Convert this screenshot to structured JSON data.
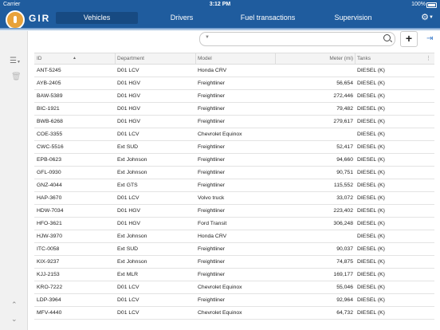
{
  "status_bar": {
    "carrier": "Carrier",
    "time": "3:12 PM",
    "battery": "100%"
  },
  "app": {
    "logo_text": "GIR",
    "tabs": [
      "Vehicles",
      "Drivers",
      "Fuel transactions",
      "Supervision"
    ],
    "active_tab": "Vehicles"
  },
  "icons": {
    "settings": "gear-icon",
    "menu": "list-menu-icon",
    "delete": "trash-icon",
    "search": "search-icon",
    "add": "plus-icon",
    "exit": "exit-icon",
    "scroll_up": "chevron-up-icon",
    "scroll_down": "chevron-down-icon"
  },
  "filter": {
    "placeholder": ""
  },
  "add_label": "+",
  "table": {
    "columns": [
      "ID",
      "Department",
      "Model",
      "Meter (mi)",
      "Tanks"
    ],
    "rows": [
      [
        "ANT-5245",
        "D01 LCV",
        "Honda CRV",
        "",
        "DIESEL (K)"
      ],
      [
        "AYB-2405",
        "D01 HGV",
        "Freightliner",
        "56,654",
        "DIESEL (K)"
      ],
      [
        "BAW-5389",
        "D01 HGV",
        "Freightliner",
        "272,446",
        "DIESEL (K)"
      ],
      [
        "BIC-1921",
        "D01 HGV",
        "Freightliner",
        "79,482",
        "DIESEL (K)"
      ],
      [
        "BWB-6268",
        "D01 HGV",
        "Freightliner",
        "279,617",
        "DIESEL (K)"
      ],
      [
        "COE-3355",
        "D01 LCV",
        "Chevrolet Equinox",
        "",
        "DIESEL (K)"
      ],
      [
        "CWC-5516",
        "Ext SUD",
        "Freightliner",
        "52,417",
        "DIESEL (K)"
      ],
      [
        "EPB-0623",
        "Ext Johnson",
        "Freightliner",
        "94,660",
        "DIESEL (K)"
      ],
      [
        "GFL-0930",
        "Ext Johnson",
        "Freightliner",
        "90,751",
        "DIESEL (K)"
      ],
      [
        "GNZ-4044",
        "Ext GTS",
        "Freightliner",
        "115,552",
        "DIESEL (K)"
      ],
      [
        "HAP-3670",
        "D01 LCV",
        "Volvo truck",
        "33,072",
        "DIESEL (K)"
      ],
      [
        "HDW-7034",
        "D01 HGV",
        "Freightliner",
        "223,402",
        "DIESEL (K)"
      ],
      [
        "HFO-3621",
        "D01 HGV",
        "Ford Transit",
        "306,248",
        "DIESEL (K)"
      ],
      [
        "HJW-3970",
        "Ext Johnson",
        "Honda CRV",
        "",
        "DIESEL (K)"
      ],
      [
        "ITC-0058",
        "Ext SUD",
        "Freightliner",
        "90,037",
        "DIESEL (K)"
      ],
      [
        "KIX-9237",
        "Ext Johnson",
        "Freightliner",
        "74,875",
        "DIESEL (K)"
      ],
      [
        "KJJ-2153",
        "Ext MLR",
        "Freightliner",
        "169,177",
        "DIESEL (K)"
      ],
      [
        "KRO-7222",
        "D01 LCV",
        "Chevrolet Equinox",
        "55,046",
        "DIESEL (K)"
      ],
      [
        "LDP-3964",
        "D01 LCV",
        "Freightliner",
        "92,964",
        "DIESEL (K)"
      ],
      [
        "MFV-4440",
        "D01 LCV",
        "Chevrolet Equinox",
        "64,732",
        "DIESEL (K)"
      ]
    ]
  },
  "colors": {
    "header_blue": "#1f5c9e",
    "active_tab": "#174a82",
    "logo_orange": "#e8a23a"
  }
}
